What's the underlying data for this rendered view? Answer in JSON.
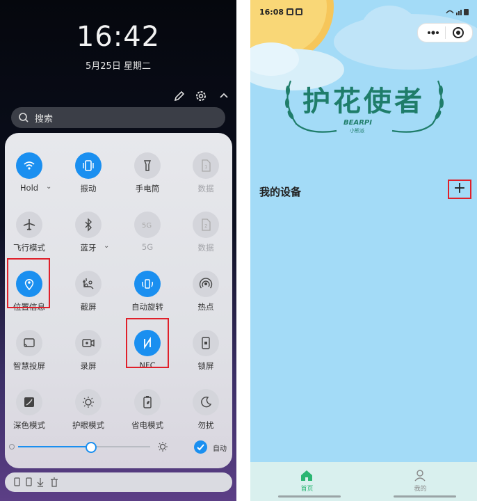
{
  "left_phone": {
    "clock": "16:42",
    "date": "5月25日 星期二",
    "search_placeholder": "搜索",
    "tiles": [
      {
        "label": "Hold",
        "icon": "wifi-icon",
        "state": "on",
        "chevron": true
      },
      {
        "label": "振动",
        "icon": "vibrate-icon",
        "state": "on",
        "chevron": false
      },
      {
        "label": "手电筒",
        "icon": "flashlight-icon",
        "state": "off",
        "chevron": false
      },
      {
        "label": "数据",
        "icon": "sim1-icon",
        "state": "disabled",
        "chevron": false
      },
      {
        "label": "飞行模式",
        "icon": "airplane-icon",
        "state": "off",
        "chevron": false
      },
      {
        "label": "蓝牙",
        "icon": "bluetooth-icon",
        "state": "off",
        "chevron": true
      },
      {
        "label": "5G",
        "icon": "5g-icon",
        "state": "disabled",
        "chevron": false
      },
      {
        "label": "数据",
        "icon": "sim2-icon",
        "state": "disabled",
        "chevron": false
      },
      {
        "label": "位置信息",
        "icon": "location-icon",
        "state": "on",
        "chevron": false
      },
      {
        "label": "截屏",
        "icon": "screenshot-icon",
        "state": "off",
        "chevron": false
      },
      {
        "label": "自动旋转",
        "icon": "rotate-icon",
        "state": "on",
        "chevron": false
      },
      {
        "label": "热点",
        "icon": "hotspot-icon",
        "state": "off",
        "chevron": false
      },
      {
        "label": "智慧投屏",
        "icon": "cast-icon",
        "state": "off",
        "chevron": false
      },
      {
        "label": "录屏",
        "icon": "record-icon",
        "state": "off",
        "chevron": false
      },
      {
        "label": "NFC",
        "icon": "nfc-icon",
        "state": "on",
        "chevron": false
      },
      {
        "label": "锁屏",
        "icon": "lock-screen-icon",
        "state": "off",
        "chevron": false
      },
      {
        "label": "深色模式",
        "icon": "dark-mode-icon",
        "state": "off",
        "chevron": false
      },
      {
        "label": "护眼模式",
        "icon": "eye-comfort-icon",
        "state": "off",
        "chevron": false
      },
      {
        "label": "省电模式",
        "icon": "battery-saver-icon",
        "state": "off",
        "chevron": false
      },
      {
        "label": "勿扰",
        "icon": "moon-icon",
        "state": "off",
        "chevron": false
      }
    ],
    "brightness": {
      "level": 0.55,
      "auto_label": "自动"
    },
    "highlighted_tiles": [
      "位置信息",
      "NFC"
    ]
  },
  "right_phone": {
    "status_time": "16:08",
    "logo_title": "护花使者",
    "logo_brand": "BEARPI",
    "logo_subtitle": "小熊派",
    "section_title": "我的设备",
    "add_button": "+",
    "tabs": [
      {
        "label": "首页",
        "icon": "home-icon",
        "active": true
      },
      {
        "label": "我的",
        "icon": "profile-icon",
        "active": false
      }
    ]
  },
  "colors": {
    "accent": "#1a8ff0",
    "brand_green": "#1f7d6a",
    "highlight_red": "#e0202a",
    "sky": "#a3dbf7"
  }
}
